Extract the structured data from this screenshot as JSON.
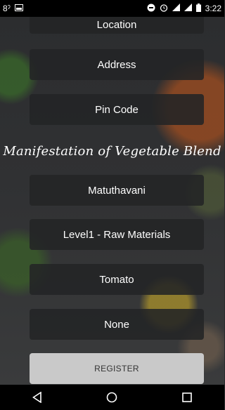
{
  "status_bar": {
    "time": "3:22",
    "left_icons": [
      "8-icon",
      "image-icon"
    ],
    "right_icons": [
      "do-not-disturb-icon",
      "alarm-icon",
      "signal-icon",
      "signal-icon",
      "battery-icon"
    ]
  },
  "form": {
    "location_label": "Location",
    "address_label": "Address",
    "pincode_label": "Pin Code",
    "section_title": "Manifestation of Vegetable Blend",
    "village_value": "Matuthavani",
    "level_value": "Level1 - Raw Materials",
    "product_value": "Tomato",
    "option_value": "None",
    "register_label": "REGISTER"
  },
  "nav": {
    "back": "back-icon",
    "home": "home-icon",
    "recents": "recents-icon"
  }
}
